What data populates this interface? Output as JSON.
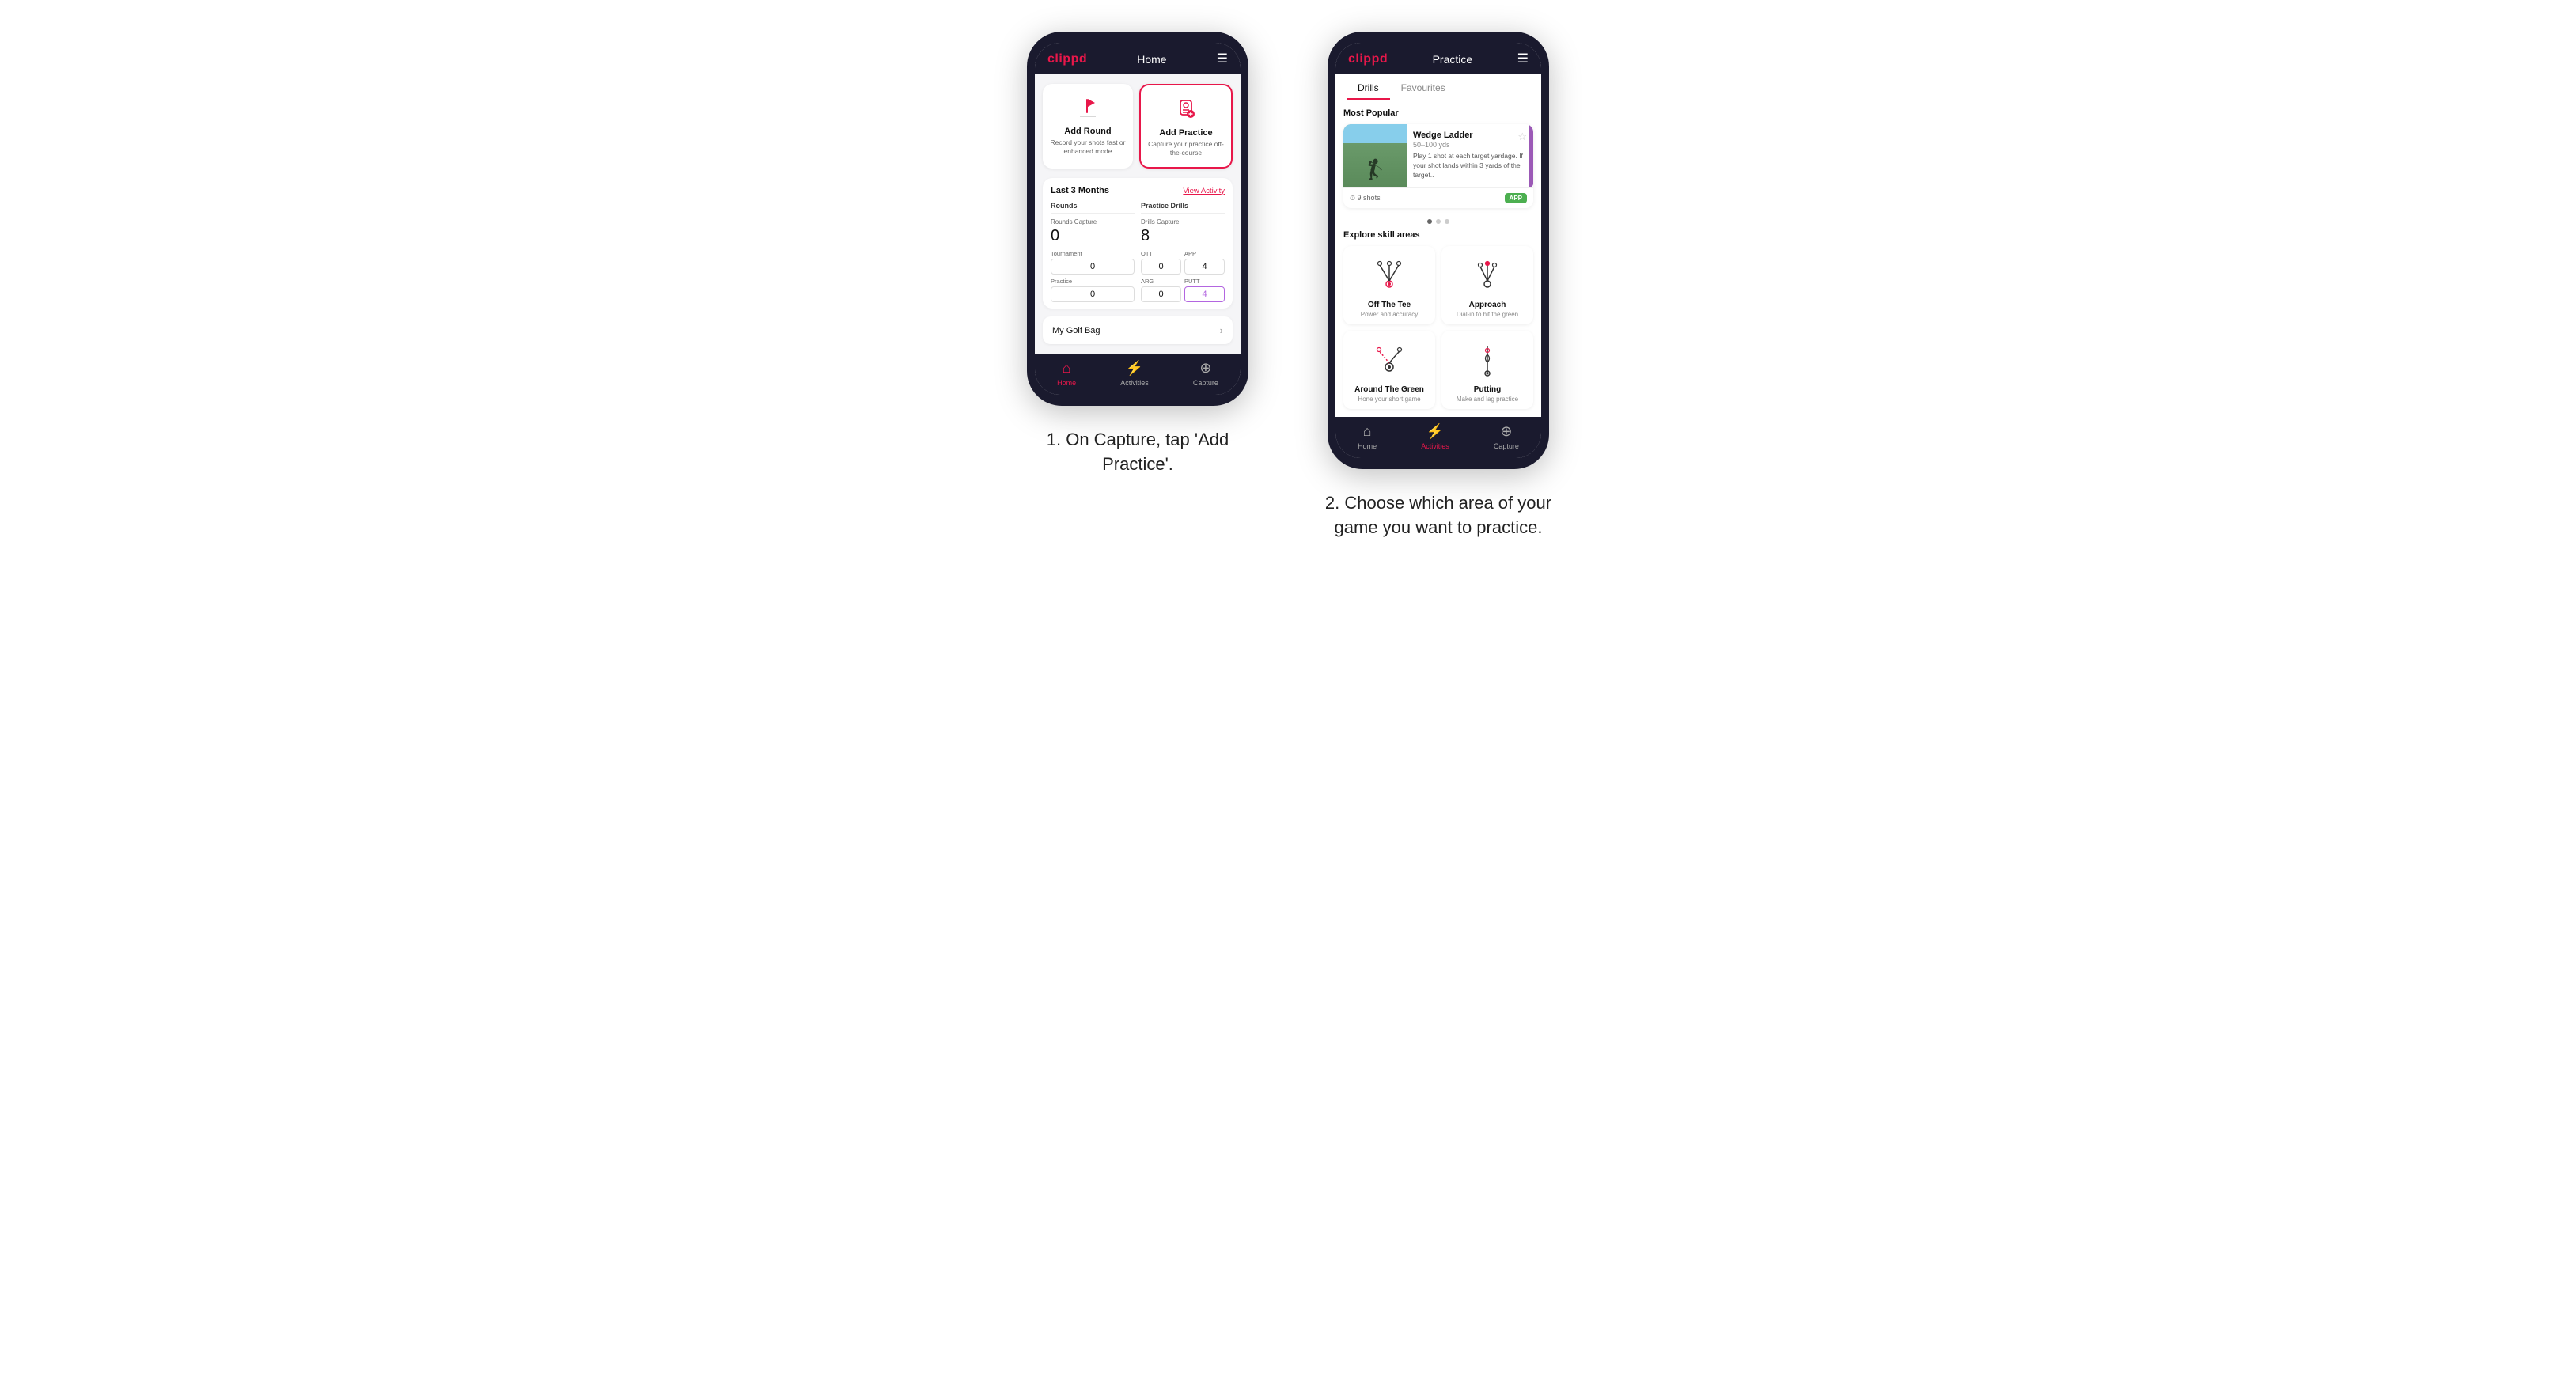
{
  "page": {
    "background": "#ffffff"
  },
  "phone1": {
    "header": {
      "logo": "clippd",
      "title": "Home",
      "menu_icon": "☰"
    },
    "action_cards": [
      {
        "id": "add-round",
        "title": "Add Round",
        "subtitle": "Record your shots fast or enhanced mode",
        "icon": "flag"
      },
      {
        "id": "add-practice",
        "title": "Add Practice",
        "subtitle": "Capture your practice off-the-course",
        "icon": "target",
        "highlighted": true
      }
    ],
    "stats": {
      "section_title": "Last 3 Months",
      "view_activity": "View Activity",
      "rounds_col": {
        "title": "Rounds",
        "rounds_capture_label": "Rounds Capture",
        "rounds_capture_value": "0",
        "tournament_label": "Tournament",
        "tournament_value": "0",
        "practice_label": "Practice",
        "practice_value": "0"
      },
      "drills_col": {
        "title": "Practice Drills",
        "drills_capture_label": "Drills Capture",
        "drills_capture_value": "8",
        "ott_label": "OTT",
        "ott_value": "0",
        "app_label": "APP",
        "app_value": "4",
        "arg_label": "ARG",
        "arg_value": "0",
        "putt_label": "PUTT",
        "putt_value": "4"
      }
    },
    "golf_bag": {
      "label": "My Golf Bag"
    },
    "bottom_nav": [
      {
        "label": "Home",
        "icon": "⌂",
        "active": true
      },
      {
        "label": "Activities",
        "icon": "⚡",
        "active": false
      },
      {
        "label": "Capture",
        "icon": "⊕",
        "active": false
      }
    ]
  },
  "phone2": {
    "header": {
      "logo": "clippd",
      "title": "Practice",
      "menu_icon": "☰"
    },
    "tabs": [
      {
        "label": "Drills",
        "active": true
      },
      {
        "label": "Favourites",
        "active": false
      }
    ],
    "most_popular": {
      "section_title": "Most Popular",
      "featured_card": {
        "title": "Wedge Ladder",
        "range": "50–100 yds",
        "description": "Play 1 shot at each target yardage. If your shot lands within 3 yards of the target..",
        "shots": "9 shots",
        "badge": "APP"
      }
    },
    "explore_title": "Explore skill areas",
    "skill_areas": [
      {
        "id": "off-the-tee",
        "title": "Off The Tee",
        "subtitle": "Power and accuracy",
        "diagram": "tee"
      },
      {
        "id": "approach",
        "title": "Approach",
        "subtitle": "Dial-in to hit the green",
        "diagram": "approach"
      },
      {
        "id": "around-the-green",
        "title": "Around The Green",
        "subtitle": "Hone your short game",
        "diagram": "atg"
      },
      {
        "id": "putting",
        "title": "Putting",
        "subtitle": "Make and lag practice",
        "diagram": "putting"
      }
    ],
    "bottom_nav": [
      {
        "label": "Home",
        "icon": "⌂",
        "active": false
      },
      {
        "label": "Activities",
        "icon": "⚡",
        "active": true
      },
      {
        "label": "Capture",
        "icon": "⊕",
        "active": false
      }
    ]
  },
  "captions": {
    "caption1": "1. On Capture, tap 'Add Practice'.",
    "caption2": "2. Choose which area of your game you want to practice."
  }
}
